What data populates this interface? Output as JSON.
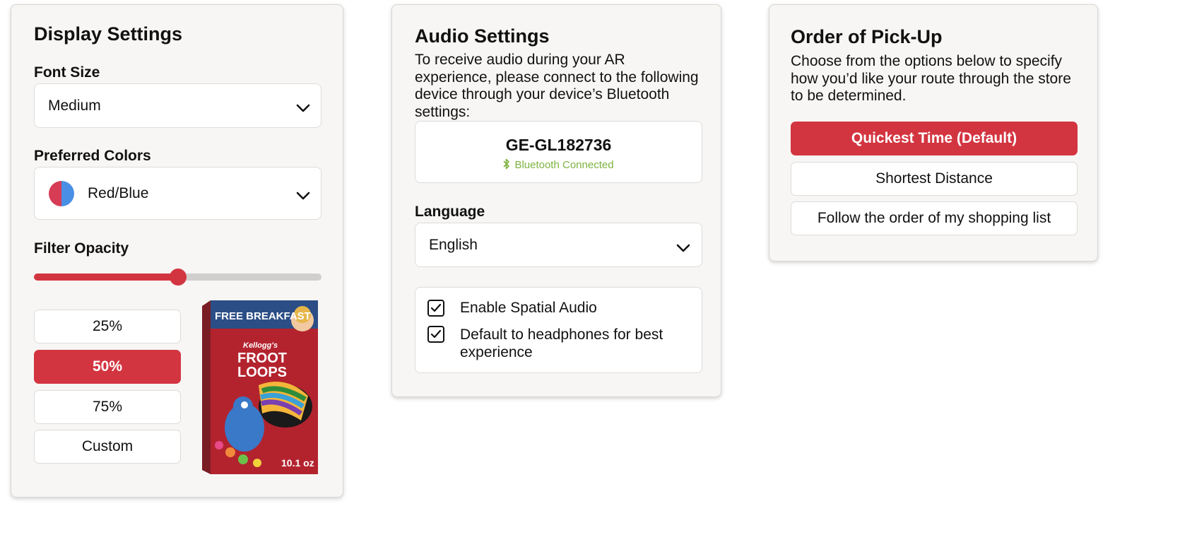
{
  "display": {
    "title": "Display Settings",
    "font_size_label": "Font Size",
    "font_size_value": "Medium",
    "colors_label": "Preferred Colors",
    "colors_value": "Red/Blue",
    "swatch_colors": [
      "#d63c55",
      "#4a8fe6"
    ],
    "opacity_label": "Filter Opacity",
    "opacity_value": 0.5,
    "opacity_options": [
      "25%",
      "50%",
      "75%",
      "Custom"
    ],
    "opacity_selected": "50%",
    "preview": {
      "top_text": "FREE BREAKFAST",
      "brand": "Kellogg's",
      "product": "FROOT LOOPS",
      "size": "10.1 oz"
    }
  },
  "audio": {
    "title": "Audio Settings",
    "description": "To receive audio during your AR experience, please connect to the following device through your device’s Bluetooth settings:",
    "device_name": "GE-GL182736",
    "device_status": "Bluetooth Connected",
    "language_label": "Language",
    "language_value": "English",
    "checkboxes": [
      {
        "label": "Enable Spatial Audio",
        "checked": true
      },
      {
        "label": "Default to headphones for best experience",
        "checked": true
      }
    ]
  },
  "pickup": {
    "title": "Order of Pick-Up",
    "description": "Choose from the options below to specify how you’d like your route through the store to be determined.",
    "options": [
      "Quickest Time (Default)",
      "Shortest Distance",
      "Follow the order of my shopping list"
    ],
    "selected": "Quickest Time (Default)"
  },
  "colors": {
    "accent": "#d33540",
    "connected": "#7db33f",
    "track": "#d0cfcd"
  }
}
